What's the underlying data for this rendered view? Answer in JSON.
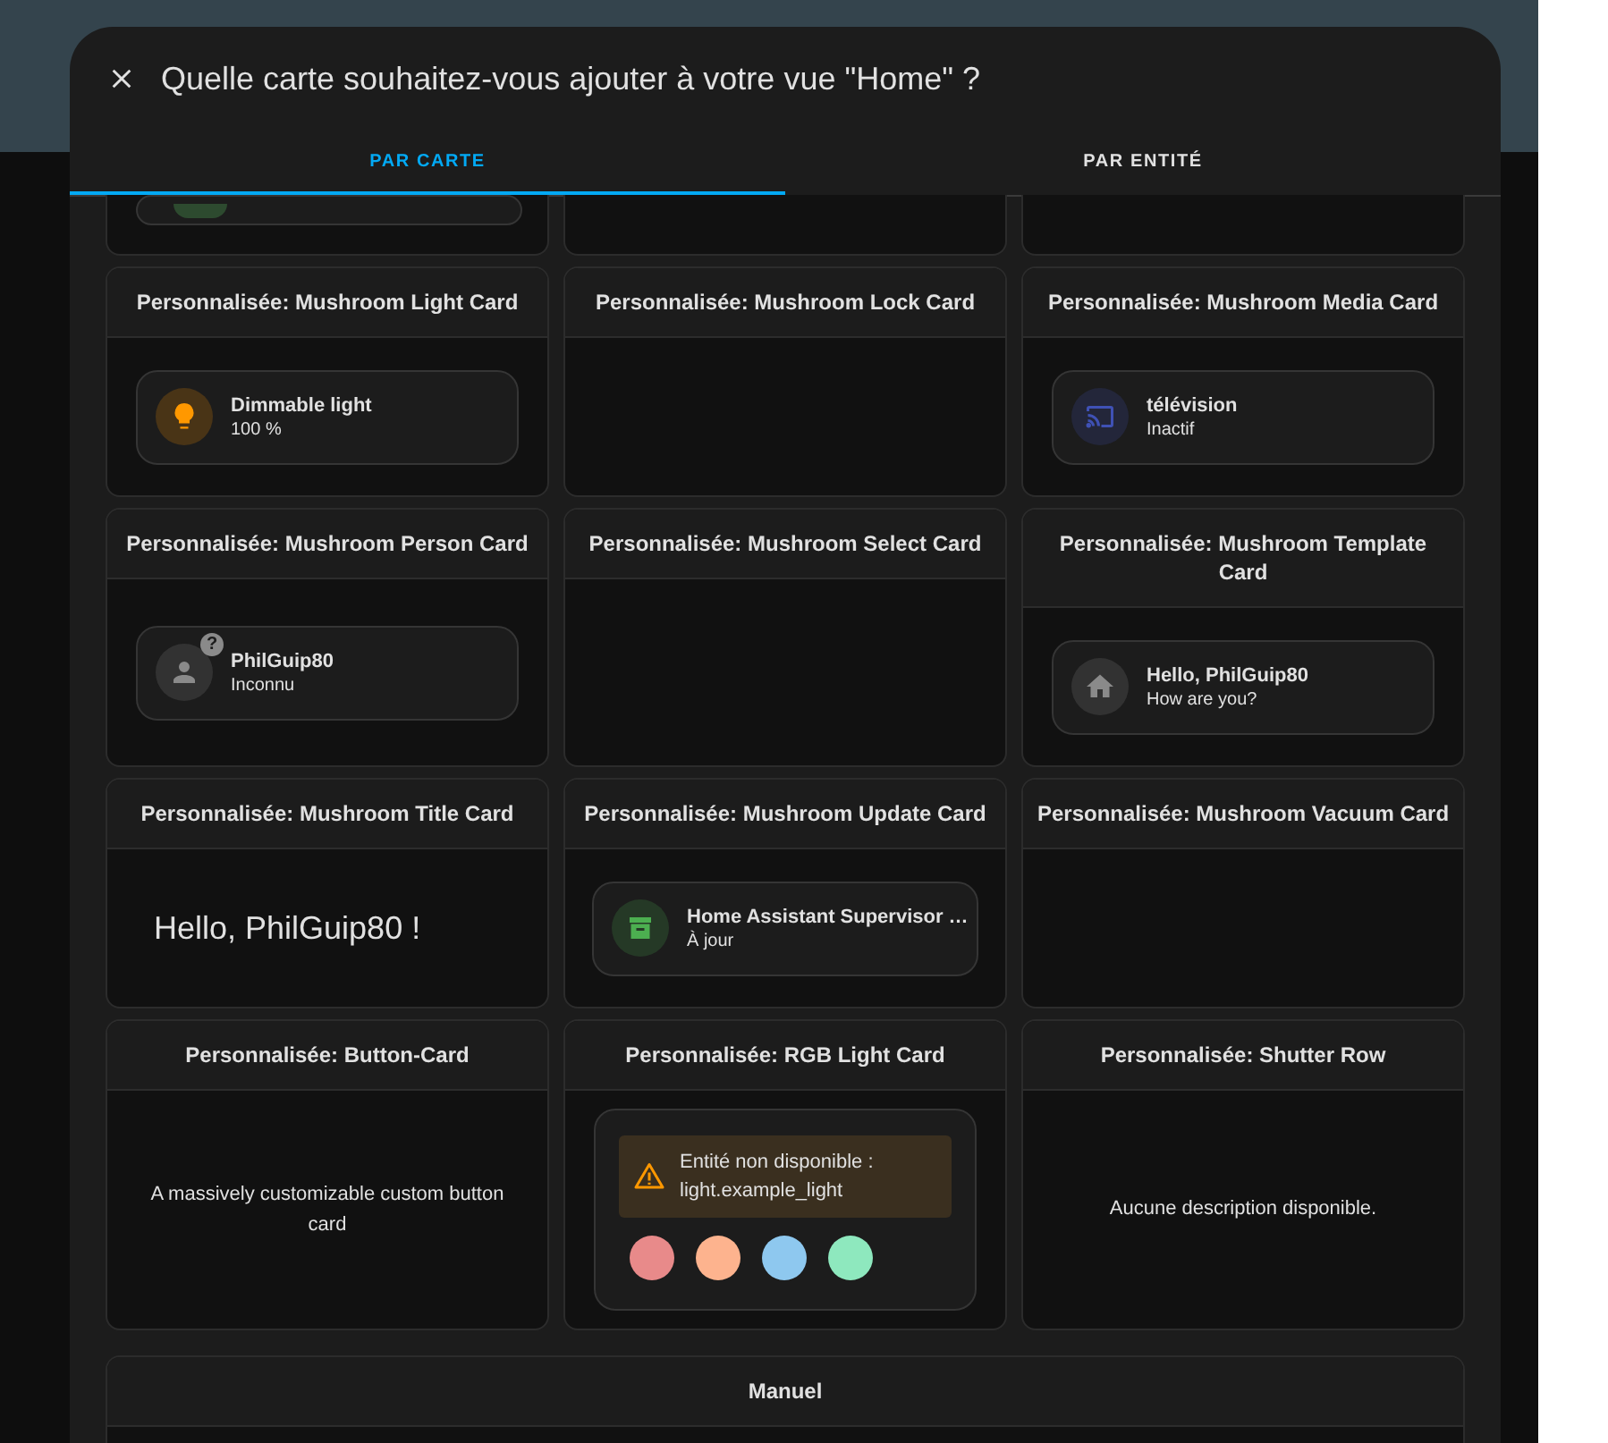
{
  "dialog": {
    "title": "Quelle carte souhaitez-vous ajouter à votre vue \"Home\" ?"
  },
  "tabs": [
    {
      "label": "PAR CARTE",
      "selected": true
    },
    {
      "label": "PAR ENTITÉ",
      "selected": false
    }
  ],
  "partial_row": [
    {
      "kind": "entity",
      "color": "#2d4a2f"
    },
    {
      "kind": "empty"
    },
    {
      "kind": "empty"
    }
  ],
  "cards": [
    {
      "title": "Personnalisée: Mushroom Light Card",
      "kind": "light",
      "color": "#ff9800",
      "primary": "Dimmable light",
      "secondary": "100 %"
    },
    {
      "title": "Personnalisée: Mushroom Lock Card",
      "kind": "empty"
    },
    {
      "title": "Personnalisée: Mushroom Media Card",
      "kind": "media",
      "color": "#3f51b5",
      "primary": "télévision",
      "secondary": "Inactif"
    },
    {
      "title": "Personnalisée: Mushroom Person Card",
      "kind": "person",
      "color": "#8a8a8a",
      "primary": "PhilGuip80",
      "secondary": "Inconnu",
      "badge": "?"
    },
    {
      "title": "Personnalisée: Mushroom Select Card",
      "kind": "empty"
    },
    {
      "title": "Personnalisée: Mushroom Template Card",
      "kind": "template",
      "color": "#8a8a8a",
      "primary": "Hello, PhilGuip80",
      "secondary": "How are you?"
    },
    {
      "title": "Personnalisée: Mushroom Title Card",
      "kind": "title",
      "text": "Hello, PhilGuip80 !"
    },
    {
      "title": "Personnalisée: Mushroom Update Card",
      "kind": "update",
      "color": "#4caf50",
      "primary": "Home Assistant Supervisor …",
      "secondary": "À jour"
    },
    {
      "title": "Personnalisée: Mushroom Vacuum Card",
      "kind": "empty"
    },
    {
      "title": "Personnalisée: Button-Card",
      "kind": "description",
      "text": "A massively customizable custom button card"
    },
    {
      "title": "Personnalisée: RGB Light Card",
      "kind": "rgb",
      "warning": "Entité non disponible : light.example_light",
      "colors": [
        {
          "color": "#e88a8a"
        },
        {
          "color": "#fdb38e"
        },
        {
          "color": "#8ec8ef"
        },
        {
          "color": "#8ee8be"
        }
      ]
    },
    {
      "title": "Personnalisée: Shutter Row",
      "kind": "description",
      "text": "Aucune description disponible."
    }
  ],
  "manual": {
    "title": "Manuel"
  }
}
